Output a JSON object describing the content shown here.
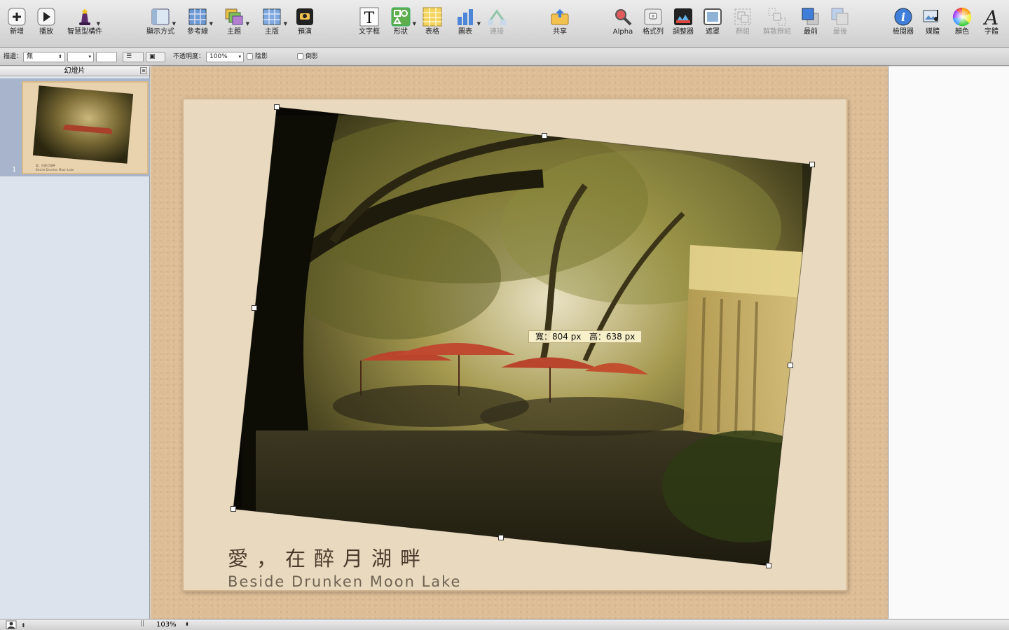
{
  "toolbar": {
    "new": "新增",
    "play": "播放",
    "smart_builds": "智慧型構件",
    "view": "顯示方式",
    "guides": "參考線",
    "themes": "主題",
    "masters": "主版",
    "preview": "預演",
    "text_box": "文字框",
    "shapes": "形狀",
    "table": "表格",
    "chart": "圖表",
    "connect": "連接",
    "share": "共享",
    "alpha": "Alpha",
    "format_bar": "格式列",
    "adjust": "調整器",
    "mask": "遮罩",
    "group": "群組",
    "ungroup": "解散群組",
    "front": "最前",
    "back": "最後",
    "inspector": "檢閱器",
    "media": "媒體",
    "colors": "顏色",
    "fonts": "字體"
  },
  "format_bar": {
    "stroke_label": "描邊：",
    "stroke_value": "無",
    "opacity_label": "不透明度：",
    "opacity_value": "100%",
    "shadow_label": "陰影",
    "reflection_label": "倒影"
  },
  "navigator": {
    "header": "幻燈片",
    "slide_number": "1",
    "thumb_caption_zh": "愛，在醉月湖畔",
    "thumb_caption_en": "Beside Drunken Moon Lake"
  },
  "slide": {
    "caption_zh": "愛，在醉月湖畔",
    "caption_en": "Beside Drunken Moon Lake",
    "dimension_tooltip": "寬：804 px   高：638 px"
  },
  "status_bar": {
    "zoom": "103%"
  },
  "colors": {
    "background_board": "#dcbd95",
    "paper": "#e9d9be",
    "umbrella": "#b9452c",
    "navigator_selection": "#a7b4cb"
  }
}
